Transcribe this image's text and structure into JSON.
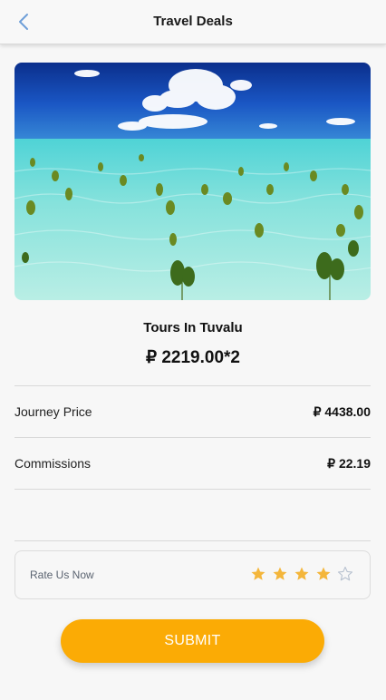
{
  "header": {
    "title": "Travel Deals",
    "back_icon": "chevron-left-icon"
  },
  "tour": {
    "name": "Tours In Tuvalu",
    "price": "₽ 2219.00*2"
  },
  "details": {
    "journey_price_label": "Journey Price",
    "journey_price_value": "₽ 4438.00",
    "commissions_label": "Commissions",
    "commissions_value": "₽ 22.19"
  },
  "rating": {
    "label": "Rate Us Now",
    "value": 4,
    "max": 5,
    "star_color": "#f4b63b",
    "empty_star_color": "#b8c2d0"
  },
  "submit": {
    "label": "SUBMIT",
    "color": "#fbab05"
  },
  "colors": {
    "back_icon": "#6f9fd8"
  }
}
